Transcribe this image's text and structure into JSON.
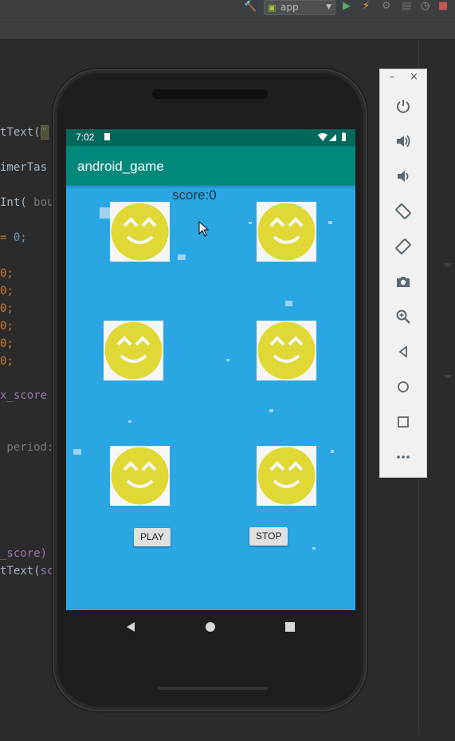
{
  "ide": {
    "run_config": "app",
    "code_lines": [
      {
        "text": "tText(",
        "tail": "\"",
        "kind": "hl"
      },
      {
        "text": "imerTas",
        "kind": "plain"
      },
      {
        "text": "Int( ",
        "tail": "bou",
        "kind": "gray"
      },
      {
        "text": "= ",
        "tail": "0;",
        "kind": "num"
      },
      {
        "text": "0;",
        "kind": "orange"
      },
      {
        "text": "0;",
        "kind": "orange"
      },
      {
        "text": "0;",
        "kind": "orange"
      },
      {
        "text": "0;",
        "kind": "orange"
      },
      {
        "text": "0;",
        "kind": "orange"
      },
      {
        "text": "0;",
        "kind": "orange"
      },
      {
        "text": "x_score",
        "kind": "purple"
      },
      {
        "text": " period:",
        "kind": "gray"
      },
      {
        "text": "_score)",
        "kind": "purple"
      },
      {
        "text": "tText(",
        "tail": "sc",
        "kind": "purple"
      }
    ]
  },
  "emulator_panel": {
    "minimize": "–",
    "close": "×",
    "buttons": [
      "power-icon",
      "volume-up-icon",
      "volume-down-icon",
      "rotate-left-icon",
      "rotate-right-icon",
      "camera-icon",
      "zoom-icon",
      "back-icon",
      "home-icon",
      "overview-icon",
      "more-icon"
    ]
  },
  "phone": {
    "status": {
      "time": "7:02"
    },
    "app_title": "android_game",
    "score_label": "score:0",
    "buttons": {
      "play": "PLAY",
      "stop": "STOP"
    }
  },
  "colors": {
    "status_bar": "#00695c",
    "app_bar": "#00897b",
    "game_bg": "#2aa6e2",
    "smiley": "#dfd835"
  }
}
